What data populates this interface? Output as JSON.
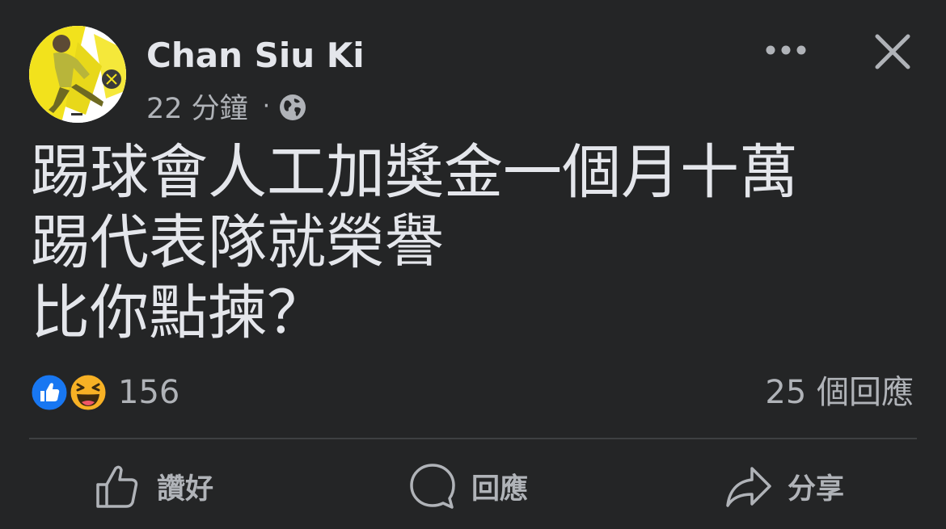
{
  "post": {
    "author": "Chan Siu Ki",
    "time": "22 分鐘",
    "separator": "·",
    "privacy_icon": "globe-icon",
    "text_lines": [
      "踢球會人工加獎金一個月十萬",
      "踢代表隊就榮譽",
      "比你點揀？"
    ]
  },
  "header": {
    "more_icon": "more-horizontal-icon",
    "close_icon": "close-icon"
  },
  "engagement": {
    "reaction_icons": [
      "like-reaction-icon",
      "haha-reaction-icon"
    ],
    "reaction_count": "156",
    "comments_count": "25 個回應"
  },
  "actions": {
    "like_label": "讚好",
    "comment_label": "回應",
    "share_label": "分享"
  },
  "colors": {
    "background": "#242526",
    "primary_text": "#e4e6eb",
    "secondary_text": "#b0b3b8",
    "divider": "#3e4042",
    "like_blue": "#1877f2",
    "haha_yellow": "#f7b125"
  }
}
